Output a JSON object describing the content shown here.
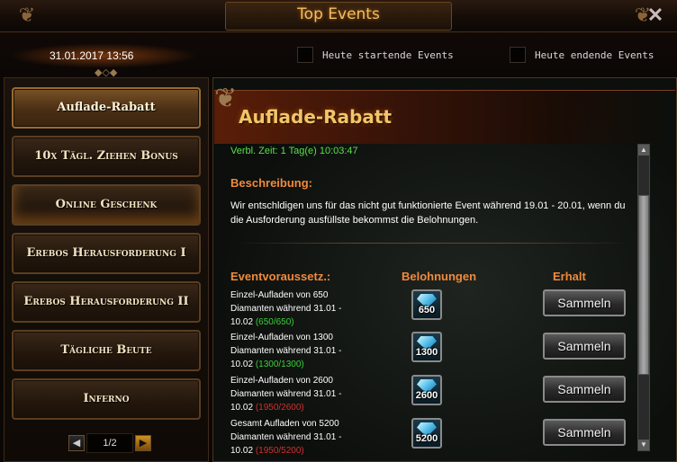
{
  "window": {
    "title": "Top Events",
    "close_glyph": "✕",
    "corner_ornament": "❦"
  },
  "header": {
    "datetime": "31.01.2017 13:56",
    "filters": [
      {
        "label": "Heute startende Events",
        "checked": false
      },
      {
        "label": "Heute endende Events",
        "checked": false
      }
    ]
  },
  "sidebar": {
    "items": [
      {
        "label": "Auflade-Rabatt",
        "active": true
      },
      {
        "label": "10x Tägl. Ziehen Bonus",
        "active": false
      },
      {
        "label": "Online Geschenk",
        "active": false
      },
      {
        "label": "Erebos Herausforderung I",
        "active": false
      },
      {
        "label": "Erebos Herausforderung II",
        "active": false
      },
      {
        "label": "Tägliche Beute",
        "active": false
      },
      {
        "label": "Inferno",
        "active": false
      }
    ],
    "pager": {
      "text": "1/2",
      "prev_glyph": "◀",
      "next_glyph": "▶"
    }
  },
  "event": {
    "title": "Auflade-Rabatt",
    "remaining": "Verbl. Zeit: 1 Tag(e) 10:03:47",
    "description_heading": "Beschreibung:",
    "description": "Wir entschldigen uns für das nicht gut funktionierte Event während 19.01 - 20.01, wenn du die Ausforderung ausfüllste bekommst die Belohnungen.",
    "columns": {
      "requirement": "Eventvoraussetz.:",
      "reward": "Belohnungen",
      "receive": "Erhalt"
    },
    "rows": [
      {
        "req_line1": "Einzel-Aufladen von 650",
        "req_line2": "Diamanten während 31.01 -",
        "req_line3": "10.02",
        "progress": "(650/650)",
        "progress_ok": true,
        "reward": "650",
        "reward_icon": "diamond-icon",
        "button": "Sammeln"
      },
      {
        "req_line1": "Einzel-Aufladen von 1300",
        "req_line2": "Diamanten während 31.01 -",
        "req_line3": "10.02",
        "progress": "(1300/1300)",
        "progress_ok": true,
        "reward": "1300",
        "reward_icon": "diamond-icon",
        "button": "Sammeln"
      },
      {
        "req_line1": "Einzel-Aufladen von 2600",
        "req_line2": "Diamanten während 31.01 -",
        "req_line3": "10.02",
        "progress": "(1950/2600)",
        "progress_ok": false,
        "reward": "2600",
        "reward_icon": "diamond-icon",
        "button": "Sammeln"
      },
      {
        "req_line1": "Gesamt Aufladen von 5200",
        "req_line2": "Diamanten während 31.01 -",
        "req_line3": "10.02",
        "progress": "(1950/5200)",
        "progress_ok": false,
        "reward": "5200",
        "reward_icon": "diamond-icon",
        "button": "Sammeln"
      }
    ]
  },
  "colors": {
    "accent_orange": "#f08a3c",
    "title_gold": "#f0c060",
    "progress_ok": "#3ad03a",
    "progress_bad": "#d03030",
    "timer_green": "#5ae04a"
  }
}
